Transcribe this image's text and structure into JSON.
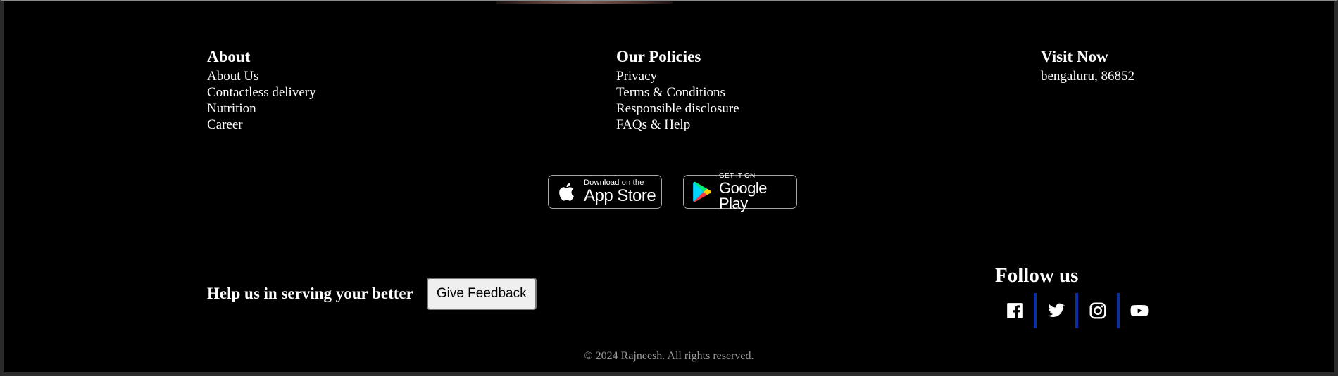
{
  "about": {
    "heading": "About",
    "links": [
      "About Us",
      "Contactless delivery",
      "Nutrition",
      "Career"
    ]
  },
  "policies": {
    "heading": "Our Policies",
    "links": [
      "Privacy",
      "Terms & Conditions",
      "Responsible disclosure",
      "FAQs & Help"
    ]
  },
  "visit": {
    "heading": "Visit Now",
    "address": "bengaluru, 86852"
  },
  "stores": {
    "app_store": {
      "small": "Download on the",
      "big": "App Store",
      "icon": "apple-icon"
    },
    "google_play": {
      "small": "GET IT ON",
      "big": "Google Play",
      "icon": "google-play-icon"
    }
  },
  "feedback": {
    "text": "Help us in serving your better",
    "button": "Give Feedback"
  },
  "follow": {
    "heading": "Follow us",
    "icons": [
      "facebook-icon",
      "twitter-icon",
      "instagram-icon",
      "youtube-icon"
    ],
    "divider_color": "#0b2fa3"
  },
  "copyright": "© 2024 Rajneesh. All rights reserved."
}
